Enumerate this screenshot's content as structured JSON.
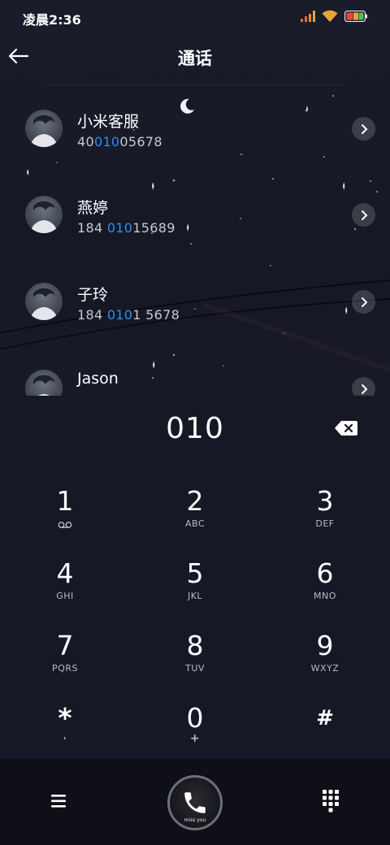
{
  "status_bar": {
    "time": "凌晨2:36",
    "icons": [
      "signal-icon",
      "wifi-icon",
      "battery-icon"
    ]
  },
  "header": {
    "title": "通话",
    "back_icon": "arrow-left-icon"
  },
  "contacts": [
    {
      "name": "小米客服",
      "number_pre": "40",
      "number_match": "010",
      "number_post": "05678"
    },
    {
      "name": "燕婷",
      "number_pre": "184 ",
      "number_match": "010",
      "number_post": "15689"
    },
    {
      "name": "子玲",
      "number_pre": "184 ",
      "number_match": "010",
      "number_post": "1 5678"
    },
    {
      "name": "Jason",
      "number_pre": "",
      "number_match": "",
      "number_post": ""
    }
  ],
  "dialer": {
    "input_value": "010",
    "keys": [
      {
        "digit": "1",
        "letters": ""
      },
      {
        "digit": "2",
        "letters": "ABC"
      },
      {
        "digit": "3",
        "letters": "DEF"
      },
      {
        "digit": "4",
        "letters": "GHI"
      },
      {
        "digit": "5",
        "letters": "JKL"
      },
      {
        "digit": "6",
        "letters": "MNO"
      },
      {
        "digit": "7",
        "letters": "PQRS"
      },
      {
        "digit": "8",
        "letters": "TUV"
      },
      {
        "digit": "9",
        "letters": "WXYZ"
      },
      {
        "digit": "*",
        "letters": ","
      },
      {
        "digit": "0",
        "letters": "+"
      },
      {
        "digit": "#",
        "letters": ""
      }
    ]
  },
  "bottom_bar": {
    "call_caption": "miss you"
  },
  "colors": {
    "background": "#151722",
    "highlight": "#2e8ff0",
    "bottom_bar": "#0f1017"
  }
}
